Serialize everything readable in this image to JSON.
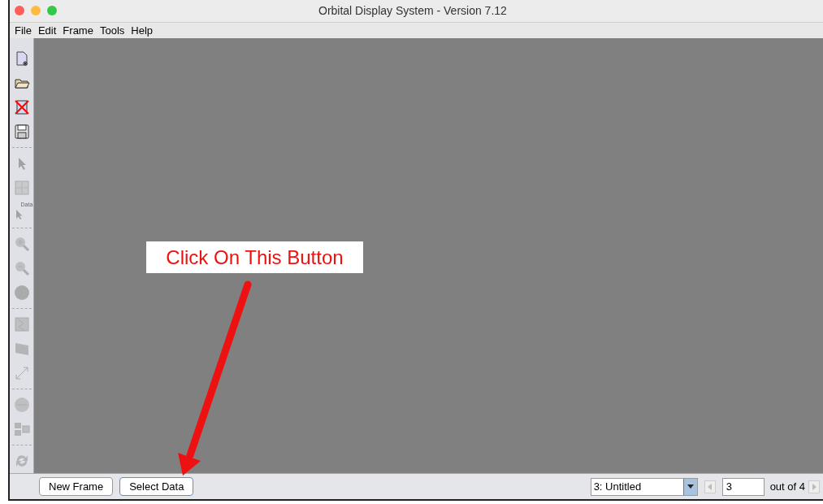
{
  "window": {
    "title": "Orbital Display System - Version 7.12"
  },
  "menu": [
    "File",
    "Edit",
    "Frame",
    "Tools",
    "Help"
  ],
  "toolbar": [
    [
      {
        "kind": "new",
        "disabled": false
      },
      {
        "kind": "open",
        "disabled": false
      },
      {
        "kind": "delete",
        "disabled": false
      },
      {
        "kind": "save",
        "disabled": false
      }
    ],
    [
      {
        "kind": "pointer",
        "disabled": true
      },
      {
        "kind": "grid",
        "disabled": true
      },
      {
        "kind": "data-pointer",
        "disabled": true,
        "label": "Data"
      }
    ],
    [
      {
        "kind": "zoom-in",
        "disabled": true
      },
      {
        "kind": "zoom-out",
        "disabled": true
      },
      {
        "kind": "globe",
        "disabled": true
      }
    ],
    [
      {
        "kind": "map",
        "disabled": true
      },
      {
        "kind": "layer",
        "disabled": true
      },
      {
        "kind": "resize",
        "disabled": true
      }
    ],
    [
      {
        "kind": "ellipse",
        "disabled": true
      },
      {
        "kind": "frames",
        "disabled": true
      }
    ],
    [
      {
        "kind": "refresh",
        "disabled": true
      }
    ]
  ],
  "callout": "Click On This Button",
  "bottom": {
    "buttons": [
      {
        "label": "New Frame",
        "focused": false
      },
      {
        "label": "Select Data",
        "focused": true
      }
    ],
    "frame_select": "3: Untitled",
    "prev_disabled": true,
    "frame_number": "3",
    "count": "out of 4",
    "next_disabled": true
  }
}
